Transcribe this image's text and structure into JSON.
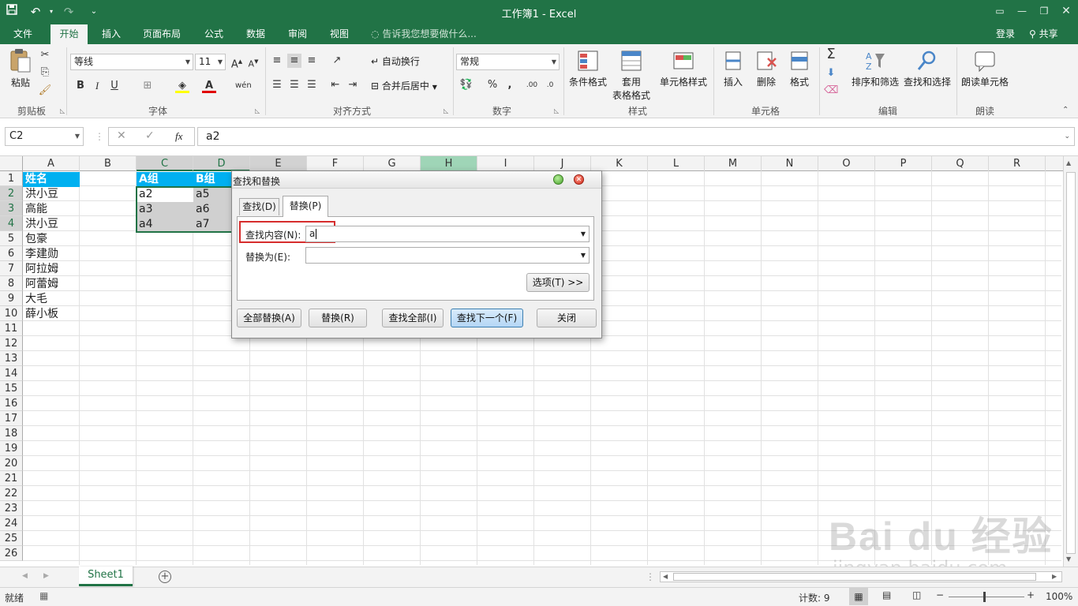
{
  "window": {
    "title": "工作簿1 - Excel"
  },
  "quick_access": {
    "save": "save-icon",
    "undo": "undo-icon",
    "redo": "redo-icon"
  },
  "tabs": [
    {
      "label": "文件",
      "active": false
    },
    {
      "label": "开始",
      "active": true
    },
    {
      "label": "插入",
      "active": false
    },
    {
      "label": "页面布局",
      "active": false
    },
    {
      "label": "公式",
      "active": false
    },
    {
      "label": "数据",
      "active": false
    },
    {
      "label": "审阅",
      "active": false
    },
    {
      "label": "视图",
      "active": false
    }
  ],
  "tell_me": "告诉我您想要做什么...",
  "account": {
    "login": "登录",
    "share": "共享"
  },
  "ribbon": {
    "clipboard": {
      "paste": "粘贴",
      "label": "剪贴板"
    },
    "font": {
      "name": "等线",
      "size": "11",
      "label": "字体"
    },
    "alignment": {
      "wrap": "自动换行",
      "merge": "合并后居中",
      "label": "对齐方式"
    },
    "number": {
      "format": "常规",
      "label": "数字"
    },
    "styles": {
      "conditional": "条件格式",
      "table1": "套用",
      "table2": "表格格式",
      "cell_styles": "单元格样式",
      "label": "样式"
    },
    "cells": {
      "insert": "插入",
      "delete": "删除",
      "format": "格式",
      "label": "单元格"
    },
    "editing": {
      "sort": "排序和筛选",
      "find": "查找和选择",
      "label": "编辑"
    },
    "reading": {
      "read": "朗读单元格",
      "label": "朗读"
    }
  },
  "formula_bar": {
    "name_box": "C2",
    "fx": "fx",
    "value": "a2"
  },
  "columns": [
    "A",
    "B",
    "C",
    "D",
    "E",
    "F",
    "G",
    "H",
    "I",
    "J",
    "K",
    "L",
    "M",
    "N",
    "O",
    "P",
    "Q",
    "R"
  ],
  "rows": [
    "1",
    "2",
    "3",
    "4",
    "5",
    "6",
    "7",
    "8",
    "9",
    "10",
    "11",
    "12",
    "13",
    "14",
    "15",
    "16",
    "17",
    "18",
    "19",
    "20",
    "21",
    "22",
    "23",
    "24",
    "25",
    "26"
  ],
  "cells": {
    "A": [
      "姓名",
      "洪小豆",
      "高能",
      "洪小豆",
      "包豪",
      "李建勋",
      "阿拉姆",
      "阿蕾姆",
      "大毛",
      "薛小板"
    ],
    "C": [
      "A组",
      "a2",
      "a3",
      "a4"
    ],
    "D": [
      "B组",
      "a5",
      "a6",
      "a7"
    ]
  },
  "dialog": {
    "title": "查找和替换",
    "tab_find": "查找(D)",
    "tab_replace": "替换(P)",
    "find_label": "查找内容(N):",
    "find_value": "a",
    "replace_label": "替换为(E):",
    "replace_value": "",
    "options": "选项(T) >>",
    "buttons": [
      "全部替换(A)",
      "替换(R)",
      "查找全部(I)",
      "查找下一个(F)",
      "关闭"
    ]
  },
  "sheet_tabs": [
    "Sheet1"
  ],
  "status": {
    "ready": "就绪",
    "count": "计数: 9",
    "zoom": "100%"
  },
  "watermark": {
    "brand": "Bai du 经验",
    "url": "jingyan.baidu.com"
  },
  "colors": {
    "excel_green": "#217346",
    "header_fill": "#00b0f0",
    "selection_gray": "#d0d0d0",
    "highlight_red": "#d62d2d"
  }
}
